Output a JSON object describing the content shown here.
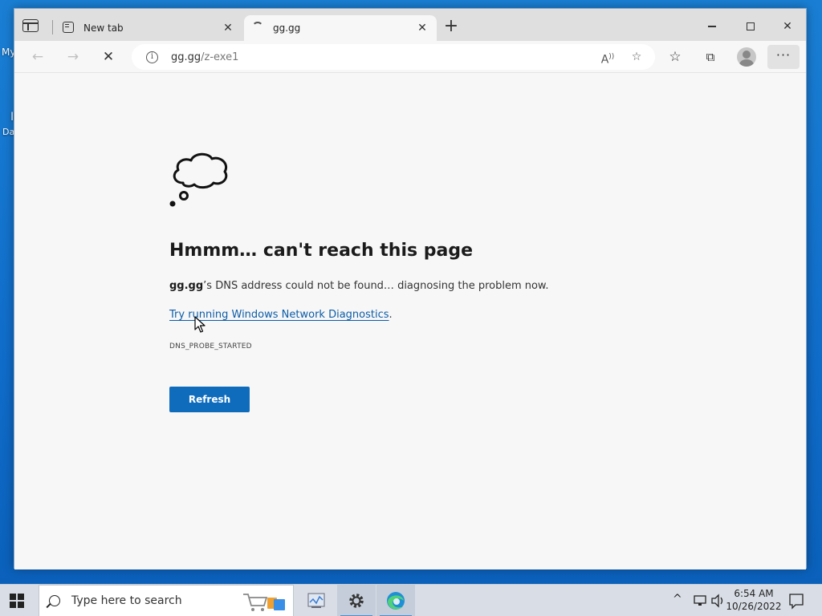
{
  "desktop": {
    "frag1": "My",
    "frag2": "I",
    "frag3": "Da"
  },
  "tabs": [
    {
      "label": "New tab"
    },
    {
      "label": "gg.gg"
    }
  ],
  "address": {
    "host": "gg.gg",
    "path": "/z-exe1"
  },
  "error": {
    "title": "Hmmm… can't reach this page",
    "host": "gg.gg",
    "description_rest": "’s DNS address could not be found… diagnosing the problem now.",
    "link": "Try running Windows Network Diagnostics",
    "link_suffix": ".",
    "code": "DNS_PROBE_STARTED",
    "refresh_label": "Refresh"
  },
  "taskbar": {
    "search_placeholder": "Type here to search",
    "time": "6:54 AM",
    "date": "10/26/2022"
  },
  "colors": {
    "accent": "#0f6cbd",
    "link": "#0b5ca8",
    "desktop": "#1a7fd4"
  }
}
